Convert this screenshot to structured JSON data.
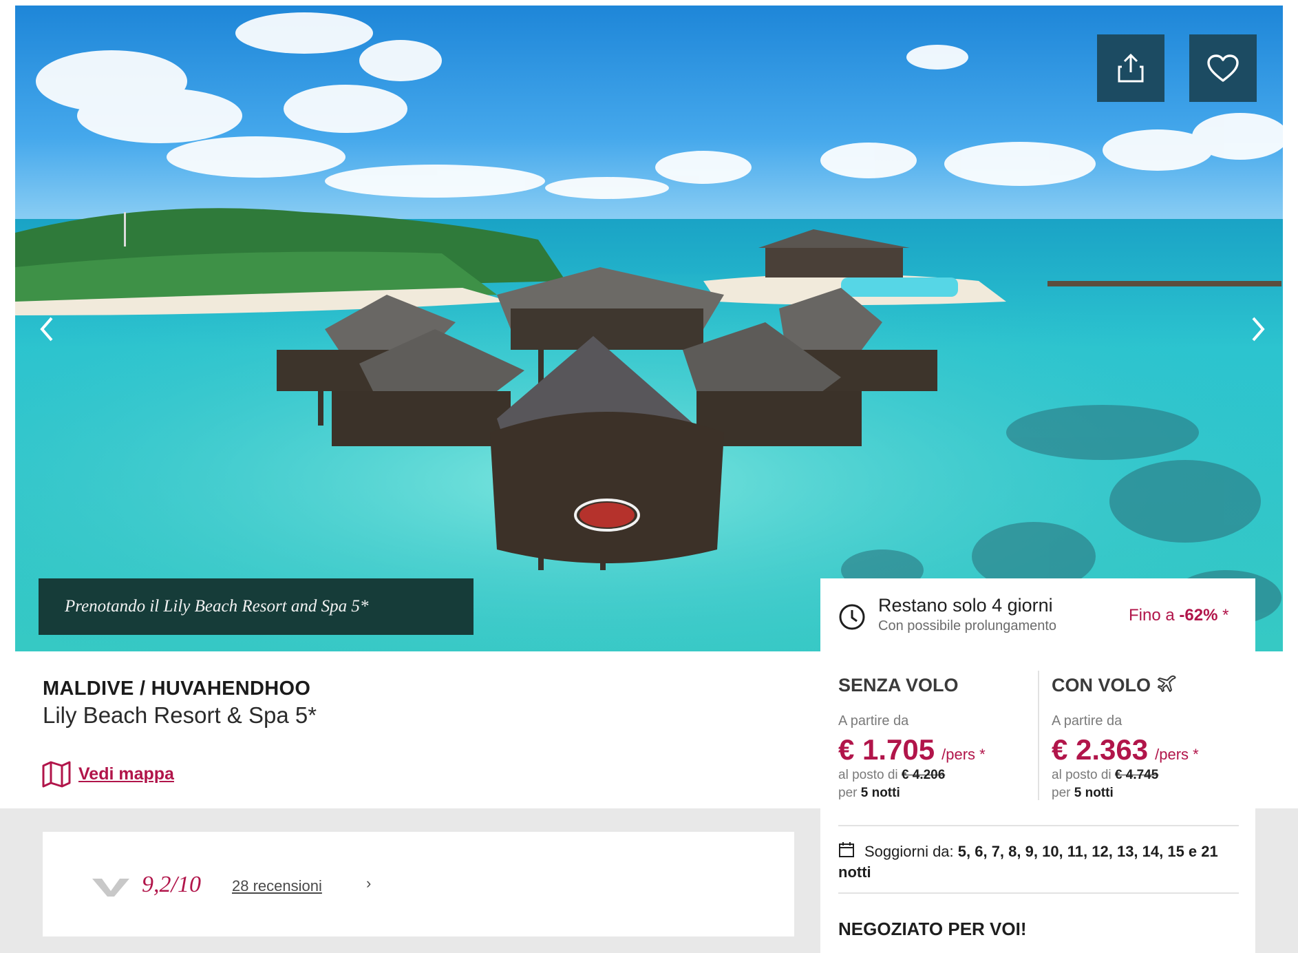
{
  "hero": {
    "caption": "Prenotando il Lily Beach Resort and Spa 5*",
    "share_icon": "share-icon",
    "favorite_icon": "heart-icon",
    "prev_icon": "chevron-left-icon",
    "next_icon": "chevron-right-icon"
  },
  "hotel": {
    "location": "MALDIVE / HUVAHENDHOO",
    "name": "Lily Beach Resort & Spa 5*",
    "map_link": "Vedi mappa"
  },
  "reviews": {
    "score": "9,2/10",
    "count_label": "28 recensioni",
    "chevron": "›"
  },
  "offer": {
    "urgency_title": "Restano solo 4 giorni",
    "urgency_sub": "Con possibile prolungamento",
    "discount_prefix": "Fino a",
    "discount_value": "-62%",
    "discount_suffix": "*",
    "without_flight": {
      "title": "SENZA VOLO",
      "from_label": "A partire da",
      "price": "€ 1.705",
      "per": "/pers *",
      "instead_label": "al posto di",
      "old_price": "€ 4.206",
      "per_label": "per",
      "nights": "5 notti"
    },
    "with_flight": {
      "title": "CON VOLO",
      "title_icon": "airplane-icon",
      "from_label": "A partire da",
      "price": "€ 2.363",
      "per": "/pers *",
      "instead_label": "al posto di",
      "old_price": "€ 4.745",
      "per_label": "per",
      "nights": "5 notti"
    },
    "stays_label": "Soggiorni da:",
    "stays_values": "5, 6, 7, 8, 9, 10, 11, 12, 13, 14, 15 e 21 notti",
    "negotiated": "NEGOZIATO PER VOI!"
  },
  "colors": {
    "accent": "#b1154a",
    "hero_button": "#1c4b62",
    "caption_bg": "#163c39",
    "strip_bg": "#e8e8e8"
  }
}
